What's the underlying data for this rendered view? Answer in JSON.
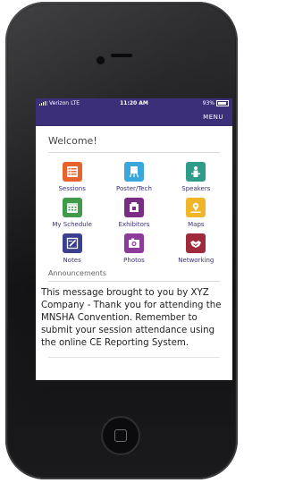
{
  "status_bar": {
    "carrier": "Verizon",
    "network": "LTE",
    "time": "11:20 AM",
    "battery": "93%"
  },
  "header": {
    "menu_label": "MENU"
  },
  "welcome": "Welcome!",
  "tiles": [
    {
      "label": "Sessions",
      "icon": "sessions-icon",
      "color": "#e8622d"
    },
    {
      "label": "Poster/Tech",
      "icon": "poster-icon",
      "color": "#3aa7dd"
    },
    {
      "label": "Speakers",
      "icon": "speakers-icon",
      "color": "#2f9c8a"
    },
    {
      "label": "My Schedule",
      "icon": "schedule-icon",
      "color": "#3f9a49"
    },
    {
      "label": "Exhibitors",
      "icon": "exhibitors-icon",
      "color": "#7b2d86"
    },
    {
      "label": "Maps",
      "icon": "maps-icon",
      "color": "#f1b52a"
    },
    {
      "label": "Notes",
      "icon": "notes-icon",
      "color": "#3b3f8f"
    },
    {
      "label": "Photos",
      "icon": "photos-icon",
      "color": "#8e3a9a"
    },
    {
      "label": "Networking",
      "icon": "networking-icon",
      "color": "#9e2a3c"
    }
  ],
  "announcements": {
    "heading": "Announcements",
    "message": "This message brought to you by XYZ Company - Thank you for attending the MNSHA Convention. Remember to submit your session attendance using the online CE Reporting System."
  },
  "theme": {
    "accent": "#3b2f7a"
  }
}
